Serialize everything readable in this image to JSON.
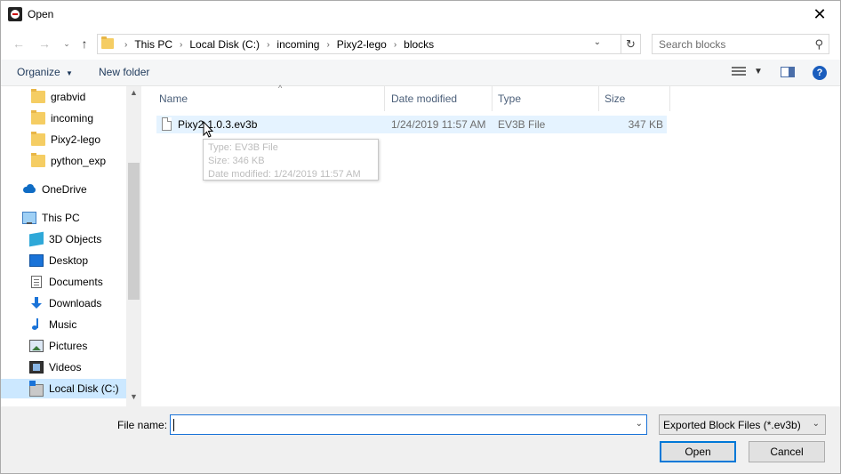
{
  "window": {
    "title": "Open"
  },
  "address": {
    "crumbs": [
      "This PC",
      "Local Disk (C:)",
      "incoming",
      "Pixy2-lego",
      "blocks"
    ]
  },
  "search": {
    "placeholder": "Search blocks"
  },
  "toolbar": {
    "organize_label": "Organize",
    "new_folder_label": "New folder"
  },
  "nav": {
    "items": [
      {
        "label": "grabvid",
        "icon": "folder-icon"
      },
      {
        "label": "incoming",
        "icon": "folder-icon"
      },
      {
        "label": "Pixy2-lego",
        "icon": "folder-icon"
      },
      {
        "label": "python_exp",
        "icon": "folder-icon"
      },
      {
        "label": "OneDrive",
        "icon": "onedrive-icon"
      },
      {
        "label": "This PC",
        "icon": "this-pc-icon"
      },
      {
        "label": "3D Objects",
        "icon": "3d-objects-icon"
      },
      {
        "label": "Desktop",
        "icon": "desktop-icon"
      },
      {
        "label": "Documents",
        "icon": "documents-icon"
      },
      {
        "label": "Downloads",
        "icon": "downloads-icon"
      },
      {
        "label": "Music",
        "icon": "music-icon"
      },
      {
        "label": "Pictures",
        "icon": "pictures-icon"
      },
      {
        "label": "Videos",
        "icon": "videos-icon"
      },
      {
        "label": "Local Disk (C:)",
        "icon": "local-disk-icon"
      }
    ]
  },
  "columns": {
    "name": "Name",
    "date": "Date modified",
    "type": "Type",
    "size": "Size"
  },
  "files": [
    {
      "name": "Pixy2-1.0.3.ev3b",
      "date": "1/24/2019 11:57 AM",
      "type": "EV3B File",
      "size": "347 KB"
    }
  ],
  "tooltip": {
    "type": "Type: EV3B File",
    "size": "Size: 346 KB",
    "date": "Date modified: 1/24/2019 11:57 AM"
  },
  "footer": {
    "file_name_label": "File name:",
    "file_name_value": "",
    "filter": "Exported Block Files (*.ev3b)",
    "open_label": "Open",
    "cancel_label": "Cancel"
  },
  "colors": {
    "accent": "#0078d7",
    "selection": "#cce8ff",
    "hover": "#e5f3ff"
  }
}
